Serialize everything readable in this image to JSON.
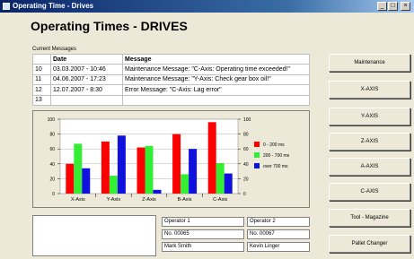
{
  "window": {
    "title": "Operating Time - Drives",
    "minimize": "_",
    "maximize": "□",
    "close": "×"
  },
  "heading": "Operating Times - DRIVES",
  "messages": {
    "section_label": "Current Messages",
    "headers": [
      "",
      "Date",
      "Message"
    ],
    "rows": [
      [
        "10",
        "03.03.2007 - 10:46",
        "Maintenance Message: \"C-Axis: Operating time exceeded!\""
      ],
      [
        "11",
        "04.06.2007 - 17:23",
        "Maintenance Message: \"Y-Axis: Check gear box oil!\""
      ],
      [
        "12",
        "12.07.2007 - 8:30",
        "Error Message: \"C-Axis: Lag error\""
      ],
      [
        "13",
        "",
        ""
      ]
    ]
  },
  "chart_data": {
    "type": "bar",
    "categories": [
      "X-Axis",
      "Y-Axis",
      "Z-Axis",
      "B-Axis",
      "C-Axis"
    ],
    "series": [
      {
        "name": "0 - 200 ms",
        "color": "#ff0000",
        "values": [
          40,
          70,
          62,
          80,
          96
        ]
      },
      {
        "name": "200 - 700 ms",
        "color": "#33ee33",
        "values": [
          67,
          24,
          64,
          26,
          41
        ]
      },
      {
        "name": "over 700 ms",
        "color": "#1111dd",
        "values": [
          34,
          78,
          5,
          60,
          27
        ]
      }
    ],
    "ylim": [
      0,
      100
    ],
    "yticks": [
      "0",
      "20",
      "40",
      "60",
      "80",
      "100"
    ],
    "grid": true,
    "legend": "right"
  },
  "operators": {
    "op1_label": "Operator 1",
    "op2_label": "Operator 2",
    "op1_no": "No. 00065",
    "op2_no": "No. 00067",
    "op1_name": "Mark Smith",
    "op2_name": "Kevin Linger"
  },
  "buttons": [
    "Maintenance",
    "X-AXIS",
    "Y-AXIS",
    "Z-AXIS",
    "A-AXIS",
    "C-AXIS",
    "Tool - Magazine",
    "Pallet Changer"
  ]
}
